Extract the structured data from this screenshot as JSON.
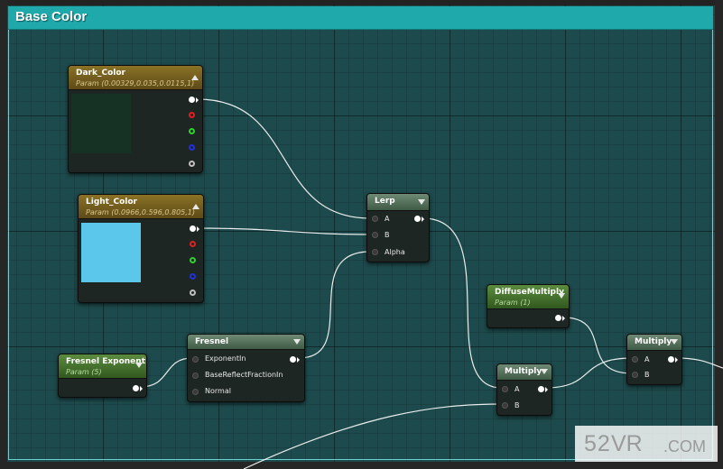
{
  "comment": {
    "title": "Base Color",
    "color": "#1fa9aa"
  },
  "nodes": {
    "dark_color": {
      "title": "Dark_Color",
      "subtitle": "Param (0.00329,0.035,0.0115,1)",
      "swatch": "#153224"
    },
    "light_color": {
      "title": "Light_Color",
      "subtitle": "Param (0.0966,0.596,0.805,1)",
      "swatch": "#5bc7ea"
    },
    "lerp": {
      "title": "Lerp",
      "inputs": [
        "A",
        "B",
        "Alpha"
      ]
    },
    "fresnel": {
      "title": "Fresnel",
      "inputs": [
        "ExponentIn",
        "BaseReflectFractionIn",
        "Normal"
      ]
    },
    "fresnel_exponent": {
      "title": "Fresnel Exponent",
      "subtitle": "Param (5)"
    },
    "diffuse_multiply": {
      "title": "DiffuseMultiply",
      "subtitle": "Param (1)"
    },
    "multiply_1": {
      "title": "Multiply",
      "inputs": [
        "A",
        "B"
      ]
    },
    "multiply_2": {
      "title": "Multiply",
      "inputs": [
        "A",
        "B"
      ]
    }
  },
  "watermark": {
    "text_num": "52",
    "text_vr": "VR",
    "text_com": ".COM"
  },
  "colors": {
    "grid_bg": "#1d4a4c",
    "param_header": "#8a7225",
    "func_header": "#6e8a74",
    "wire": "#ffffff"
  },
  "icons": [
    "collapse-arrow-icon",
    "dropdown-arrow-icon",
    "output-pin-icon",
    "input-pin-icon"
  ]
}
